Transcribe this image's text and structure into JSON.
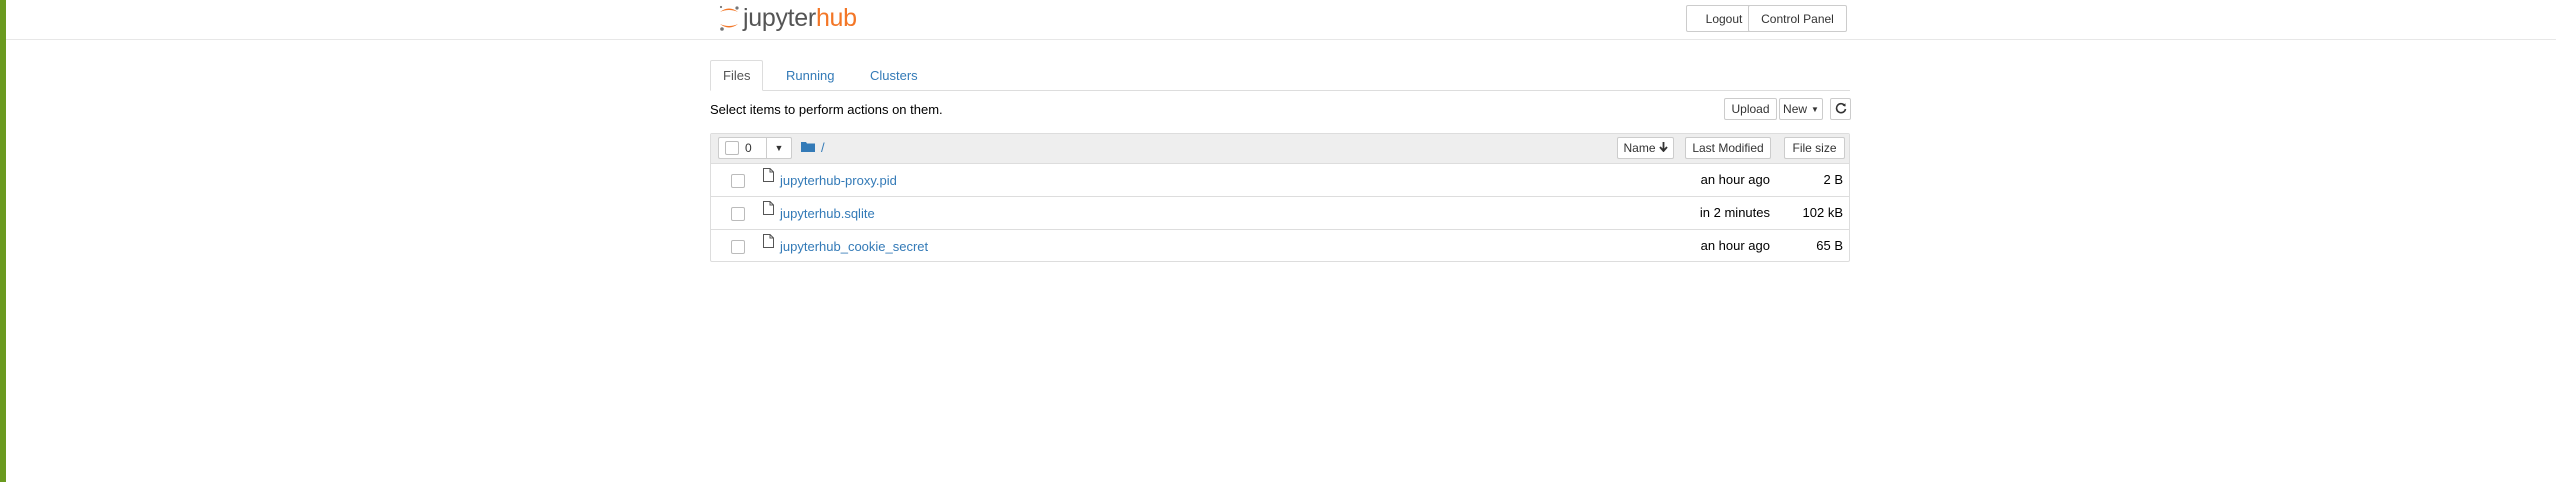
{
  "colors": {
    "accent_bar": "#6a9a1f",
    "logo_hub": "#f37626",
    "link": "#337ab7"
  },
  "header": {
    "logo": {
      "part1": "jupyter",
      "part2": "hub",
      "icon": "jupyter-logo-icon"
    },
    "logout_label": "Logout",
    "control_panel_label": "Control Panel"
  },
  "tabs": [
    {
      "label": "Files",
      "active": true
    },
    {
      "label": "Running",
      "active": false
    },
    {
      "label": "Clusters",
      "active": false
    }
  ],
  "toolbar": {
    "hint": "Select items to perform actions on them.",
    "upload_label": "Upload",
    "new_label": "New",
    "refresh_icon": "refresh-icon"
  },
  "list_header": {
    "selected_count": "0",
    "breadcrumb_path": "/",
    "breadcrumb_icon": "folder-icon",
    "sort_name_label": "Name",
    "sort_name_icon": "arrow-down-icon",
    "last_modified_label": "Last Modified",
    "file_size_label": "File size"
  },
  "files": [
    {
      "name": "jupyterhub-proxy.pid",
      "modified": "an hour ago",
      "size": "2 B"
    },
    {
      "name": "jupyterhub.sqlite",
      "modified": "in 2 minutes",
      "size": "102 kB"
    },
    {
      "name": "jupyterhub_cookie_secret",
      "modified": "an hour ago",
      "size": "65 B"
    }
  ]
}
